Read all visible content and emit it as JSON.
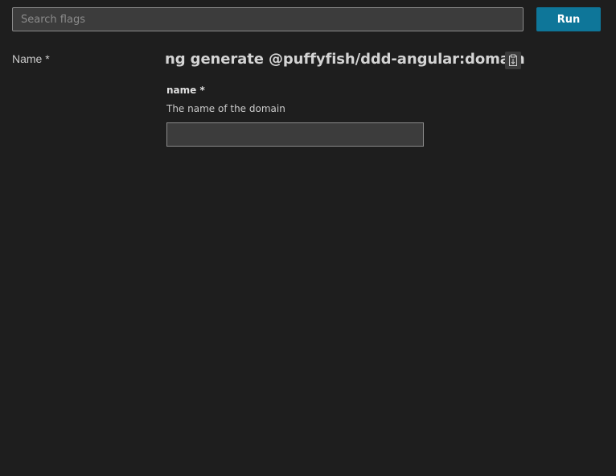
{
  "search": {
    "placeholder": "Search flags",
    "value": ""
  },
  "toolbar": {
    "run_label": "Run"
  },
  "sidebar": {
    "items": [
      {
        "label": "Name *"
      }
    ]
  },
  "main": {
    "command": "ng generate @puffyfish/ddd-angular:domain",
    "copy_icon": "copy-command-icon",
    "fields": [
      {
        "label": "name *",
        "description": "The name of the domain",
        "value": ""
      }
    ]
  },
  "colors": {
    "background": "#1e1e1e",
    "input_background": "#3c3c3c",
    "accent": "#0e7699"
  }
}
